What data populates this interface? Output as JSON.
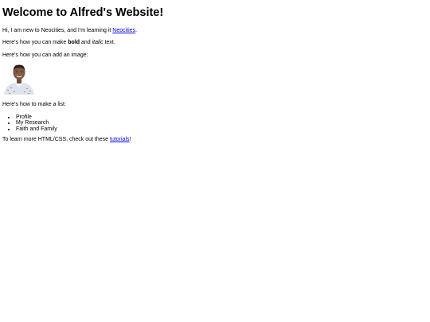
{
  "heading": "Welcome to Alfred's Website!",
  "intro": {
    "text": "Hi, I am new to Neocities, and I'm learning it ",
    "link_text": "Neocities",
    "suffix": "."
  },
  "formatting": {
    "prefix": "Here's how you can make ",
    "bold": "bold",
    "middle": " and ",
    "italic": "italic",
    "suffix": " text."
  },
  "image_intro": "Here's how you can add an image:",
  "list_intro": "Here's how to make a list:",
  "list_items": [
    "Profile",
    "My Research",
    "Faith and Family"
  ],
  "outro": {
    "prefix": "To learn more HTML/CSS, check out these ",
    "link_text": "tutorials",
    "suffix": "!"
  },
  "colors": {
    "link": "#0000ee",
    "text": "#000000",
    "background": "#ffffff"
  }
}
